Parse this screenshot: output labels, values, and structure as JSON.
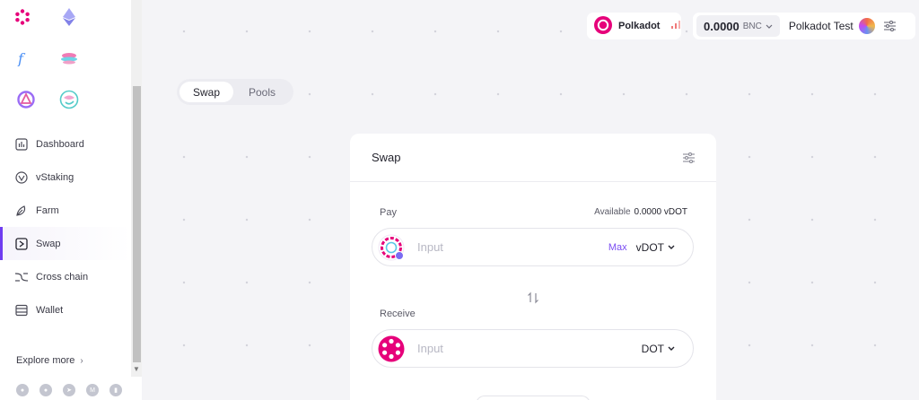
{
  "sidebar": {
    "chains": [
      {
        "icon": "polkadot-icon",
        "color": "#e6007a"
      },
      {
        "icon": "ethereum-icon",
        "color": "#8c8cf0"
      },
      {
        "icon": "filecoin-icon",
        "color": "#4a8ff5"
      },
      {
        "icon": "astar-icon",
        "color": "#e45aa0"
      },
      {
        "icon": "bifrost-icon",
        "color": "#9b6cf5"
      },
      {
        "icon": "moonbeam-icon",
        "color": "#53cbc9"
      }
    ],
    "nav": [
      {
        "id": "dashboard",
        "label": "Dashboard",
        "icon": "dashboard-icon"
      },
      {
        "id": "vstaking",
        "label": "vStaking",
        "icon": "vstaking-icon"
      },
      {
        "id": "farm",
        "label": "Farm",
        "icon": "farm-icon"
      },
      {
        "id": "swap",
        "label": "Swap",
        "icon": "swap-icon"
      },
      {
        "id": "cross-chain",
        "label": "Cross chain",
        "icon": "cross-chain-icon"
      },
      {
        "id": "wallet",
        "label": "Wallet",
        "icon": "wallet-icon"
      }
    ],
    "active": "swap",
    "explore_label": "Explore more",
    "social": [
      "github-icon",
      "twitter-icon",
      "telegram-icon",
      "medium-icon",
      "analytics-icon"
    ]
  },
  "header": {
    "network": "Polkadot",
    "balance_amount": "0.0000",
    "balance_unit": "BNC",
    "account_name": "Polkadot Test"
  },
  "tabs": {
    "swap": "Swap",
    "pools": "Pools"
  },
  "card": {
    "title": "Swap",
    "pay": {
      "label": "Pay",
      "available_label": "Available",
      "available_value": "0.0000 vDOT",
      "placeholder": "Input",
      "max_label": "Max",
      "token": "vDOT"
    },
    "receive": {
      "label": "Receive",
      "placeholder": "Input",
      "token": "DOT"
    }
  },
  "colors": {
    "accent": "#6f3df0",
    "polkadot": "#e6007a"
  }
}
